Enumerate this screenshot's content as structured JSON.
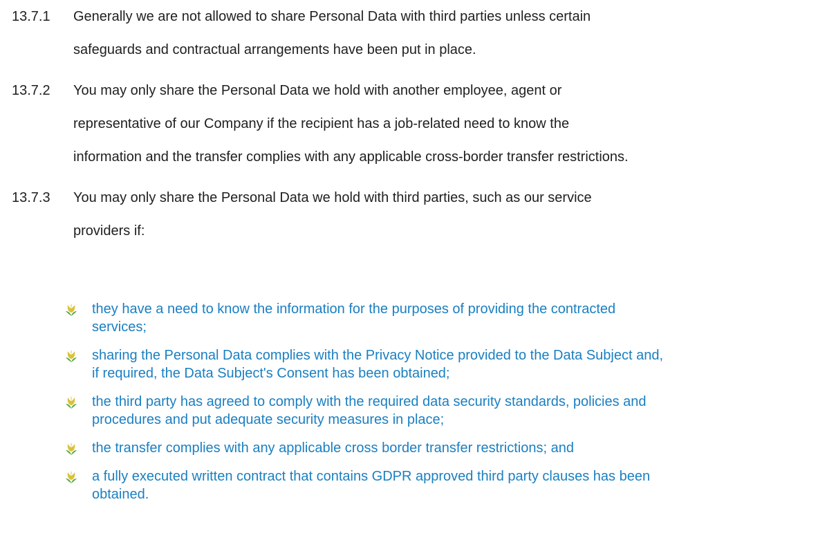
{
  "clauses": [
    {
      "number": "13.7.1",
      "lines": [
        "Generally we are not allowed to share Personal Data with third parties unless certain",
        "safeguards and contractual arrangements have been put in place."
      ]
    },
    {
      "number": "13.7.2",
      "lines": [
        "You may only share the Personal Data we hold with another employee, agent or",
        "representative of our Company if the recipient has a job-related need to know the",
        "information and the transfer complies with any applicable cross-border transfer restrictions."
      ]
    },
    {
      "number": "13.7.3",
      "lines": [
        "You may only share the Personal Data we hold with third parties, such as our service",
        "providers if:"
      ]
    }
  ],
  "bullets": [
    {
      "icon": "tulip-bullet-icon",
      "lines": [
        "they have a need to know the information for the purposes of providing the contracted",
        "services;"
      ]
    },
    {
      "icon": "tulip-bullet-icon",
      "lines": [
        "sharing the Personal Data complies with the Privacy Notice provided to the Data Subject and,",
        "if required, the Data Subject's Consent has been obtained;"
      ]
    },
    {
      "icon": "tulip-bullet-icon",
      "lines": [
        "the third party has agreed to comply with the required data security standards, policies and",
        "procedures and put adequate security measures in place;"
      ]
    },
    {
      "icon": "tulip-bullet-icon",
      "lines": [
        "the transfer complies with any applicable cross border transfer restrictions; and"
      ]
    },
    {
      "icon": "tulip-bullet-icon",
      "lines": [
        "a fully executed written contract that contains GDPR approved third party clauses has been",
        "obtained."
      ]
    }
  ],
  "colors": {
    "body_text": "#1f1f1f",
    "bullet_text": "#1a7fc1",
    "icon_petal": "#d9c23a",
    "icon_leaf": "#5aa83a"
  }
}
